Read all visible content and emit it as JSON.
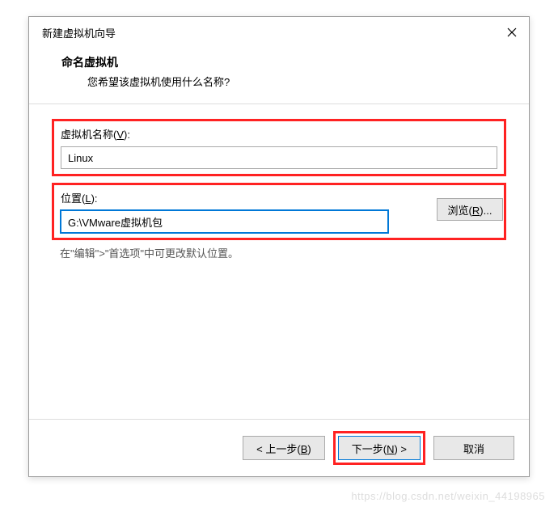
{
  "dialog": {
    "title": "新建虚拟机向导",
    "header_title": "命名虚拟机",
    "header_subtitle": "您希望该虚拟机使用什么名称?"
  },
  "fields": {
    "name_label_prefix": "虚拟机名称(",
    "name_label_key": "V",
    "name_label_suffix": "):",
    "name_value": "Linux",
    "location_label_prefix": "位置(",
    "location_label_key": "L",
    "location_label_suffix": "):",
    "location_value": "G:\\VMware虚拟机包",
    "browse_prefix": "浏览(",
    "browse_key": "R",
    "browse_suffix": ")...",
    "hint": "在\"编辑\">\"首选项\"中可更改默认位置。"
  },
  "buttons": {
    "back_prefix": "< 上一步(",
    "back_key": "B",
    "back_suffix": ")",
    "next_prefix": "下一步(",
    "next_key": "N",
    "next_suffix": ") >",
    "cancel": "取消"
  },
  "watermark": "https://blog.csdn.net/weixin_44198965"
}
